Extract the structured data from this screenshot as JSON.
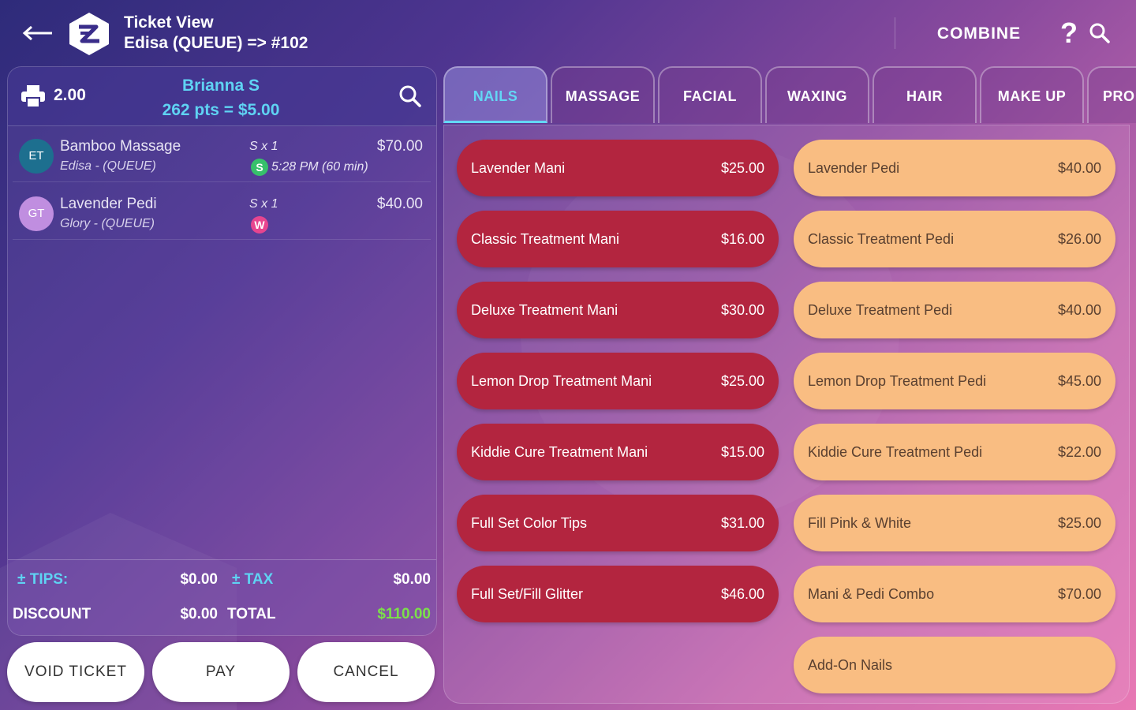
{
  "header": {
    "title": "Ticket View",
    "subtitle": "Edisa (QUEUE) => #102",
    "combine_label": "COMBINE",
    "help_label": "?"
  },
  "ticket": {
    "amount": "2.00",
    "customer_name": "Brianna S",
    "points": "262 pts = $5.00",
    "items": [
      {
        "initials": "ET",
        "avatar_color": "#1d6f8f",
        "name": "Bamboo Massage",
        "staff": "Edisa - (QUEUE)",
        "qty": "S x 1",
        "price": "$70.00",
        "status": "S",
        "status_color": "#37c06b",
        "time": "5:28 PM (60 min)"
      },
      {
        "initials": "GT",
        "avatar_color": "#c08ee0",
        "name": "Lavender Pedi",
        "staff": "Glory - (QUEUE)",
        "qty": "S x 1",
        "price": "$40.00",
        "status": "W",
        "status_color": "#e7458f",
        "time": ""
      }
    ],
    "totals": {
      "tips_label": "± TIPS:",
      "tips_value": "$0.00",
      "tax_label": "± TAX",
      "tax_value": "$0.00",
      "discount_label": "DISCOUNT",
      "discount_value": "$0.00",
      "total_label": "TOTAL",
      "total_value": "$110.00"
    }
  },
  "actions": {
    "void_label": "VOID TICKET",
    "pay_label": "PAY",
    "cancel_label": "CANCEL"
  },
  "tabs": [
    {
      "label": "NAILS",
      "active": true
    },
    {
      "label": "MASSAGE",
      "active": false
    },
    {
      "label": "FACIAL",
      "active": false
    },
    {
      "label": "WAXING",
      "active": false
    },
    {
      "label": "HAIR",
      "active": false
    },
    {
      "label": "MAKE UP",
      "active": false
    },
    {
      "label": "PRO",
      "active": false
    }
  ],
  "services": {
    "left": [
      {
        "name": "Lavender Mani",
        "price": "$25.00"
      },
      {
        "name": "Classic Treatment Mani",
        "price": "$16.00"
      },
      {
        "name": "Deluxe Treatment Mani",
        "price": "$30.00"
      },
      {
        "name": "Lemon Drop Treatment Mani",
        "price": "$25.00"
      },
      {
        "name": "Kiddie Cure Treatment Mani",
        "price": "$15.00"
      },
      {
        "name": "Full Set Color Tips",
        "price": "$31.00"
      },
      {
        "name": "Full Set/Fill Glitter",
        "price": "$46.00"
      }
    ],
    "right": [
      {
        "name": "Lavender Pedi",
        "price": "$40.00"
      },
      {
        "name": "Classic Treatment Pedi",
        "price": "$26.00"
      },
      {
        "name": "Deluxe Treatment Pedi",
        "price": "$40.00"
      },
      {
        "name": "Lemon Drop Treatment Pedi",
        "price": "$45.00"
      },
      {
        "name": "Kiddie Cure Treatment Pedi",
        "price": "$22.00"
      },
      {
        "name": "Fill Pink & White",
        "price": "$25.00"
      },
      {
        "name": "Mani & Pedi Combo",
        "price": "$70.00"
      },
      {
        "name": "Add-On Nails",
        "price": ""
      }
    ]
  },
  "colors": {
    "accent_cyan": "#5fd3f3",
    "total_green": "#7be04a",
    "service_red": "#b3253f",
    "service_peach": "#f9bd82"
  }
}
